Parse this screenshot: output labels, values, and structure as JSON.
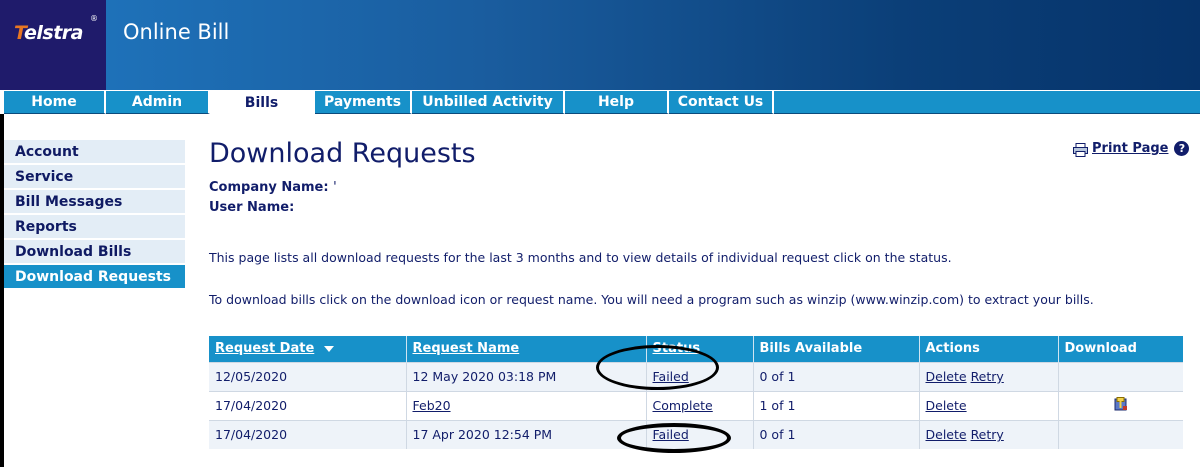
{
  "header": {
    "logo_text": "Telstra",
    "logo_first_letter": "T",
    "logo_rest": "elstra",
    "logo_reg": "®",
    "app_title": "Online Bill"
  },
  "nav": {
    "tabs": [
      {
        "label": "Home"
      },
      {
        "label": "Admin"
      },
      {
        "label": "Bills",
        "active": true
      },
      {
        "label": "Payments"
      },
      {
        "label": "Unbilled Activity"
      },
      {
        "label": "Help"
      },
      {
        "label": "Contact Us"
      }
    ]
  },
  "sidebar": {
    "items": [
      {
        "label": "Account"
      },
      {
        "label": "Service"
      },
      {
        "label": "Bill Messages"
      },
      {
        "label": "Reports"
      },
      {
        "label": "Download Bills"
      },
      {
        "label": "Download Requests",
        "active": true
      }
    ]
  },
  "main": {
    "title": "Download Requests",
    "print_label": "Print Page",
    "help_glyph": "?",
    "company_label": "Company Name:",
    "company_value": "'",
    "user_label": "User Name:",
    "user_value": "",
    "para1": "This page lists all download requests for the last 3 months and to view details of individual request click on the status.",
    "para2": "To download bills click on the download icon or request name. You will need a program such as winzip (www.winzip.com) to extract your bills."
  },
  "table": {
    "headers": {
      "request_date": "Request Date",
      "request_name": "Request Name",
      "status": "Status",
      "bills_available": "Bills Available",
      "actions": "Actions",
      "download": "Download"
    },
    "rows": [
      {
        "date": "12/05/2020",
        "name": "12 May 2020 03:18 PM",
        "name_link": false,
        "status": "Failed",
        "bills": "0 of 1",
        "delete": "Delete",
        "retry": "Retry",
        "download_icon": false
      },
      {
        "date": "17/04/2020",
        "name": "Feb20",
        "name_link": true,
        "status": "Complete",
        "bills": "1 of 1",
        "delete": "Delete",
        "retry": "",
        "download_icon": true
      },
      {
        "date": "17/04/2020",
        "name": "17 Apr 2020 12:54 PM",
        "name_link": false,
        "status": "Failed",
        "bills": "0 of 1",
        "delete": "Delete",
        "retry": "Retry",
        "download_icon": false
      }
    ]
  },
  "colors": {
    "brand_blue": "#1791c9",
    "navy_text": "#111d6a",
    "logo_bg": "#1f1b6b",
    "logo_accent": "#e87722"
  },
  "icons": {
    "print": "printer-icon",
    "help": "help-icon",
    "sort": "sort-down-arrow-icon",
    "download": "zip-archive-icon"
  }
}
